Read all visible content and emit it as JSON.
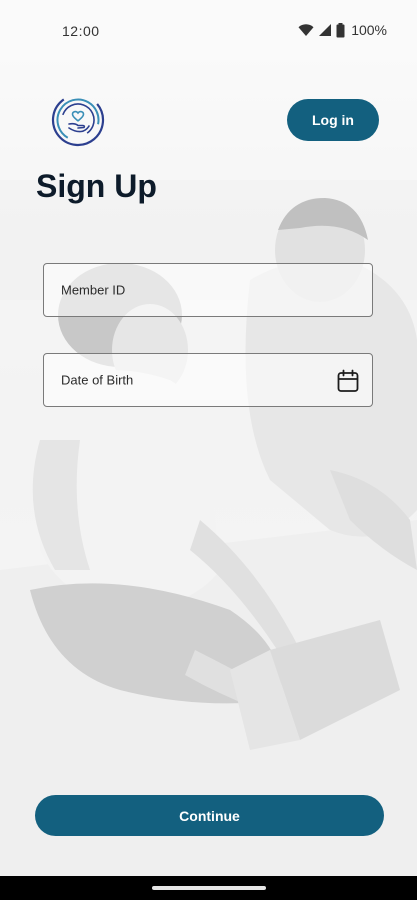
{
  "status_bar": {
    "time": "12:00",
    "battery": "100%",
    "icons": [
      "wifi-icon",
      "signal-icon",
      "battery-icon"
    ]
  },
  "header": {
    "logo_icon": "care-hand-heart-logo",
    "login_label": "Log in"
  },
  "page": {
    "title": "Sign Up"
  },
  "form": {
    "member_id_label": "Member ID",
    "dob_label": "Date of Birth",
    "dob_icon": "calendar-icon"
  },
  "footer": {
    "continue_label": "Continue"
  },
  "colors": {
    "primary": "#13607f",
    "title": "#0d1b2a",
    "logo_blue": "#2c3f8f",
    "logo_teal": "#3a8fb7"
  }
}
